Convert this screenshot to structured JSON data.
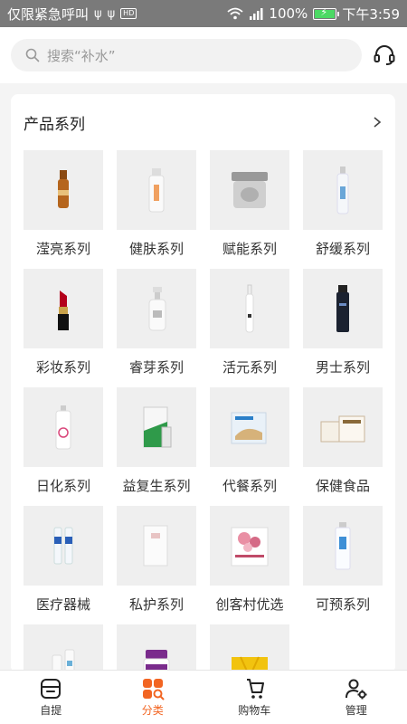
{
  "status_bar": {
    "carrier": "仅限紧急呼叫",
    "extra_icons": [
      "usb-icon",
      "usb-icon",
      "hd-icon"
    ],
    "hd_text": "HD",
    "battery_percent": "100%",
    "battery_level": 1.0,
    "time": "下午3:59"
  },
  "search": {
    "placeholder": "搜索“补水”"
  },
  "section": {
    "title": "产品系列"
  },
  "categories": [
    {
      "label": "滢亮系列",
      "icon": "ampoule"
    },
    {
      "label": "健肤系列",
      "icon": "white-bottle"
    },
    {
      "label": "赋能系列",
      "icon": "silver-jar"
    },
    {
      "label": "舒缓系列",
      "icon": "spray-bottle"
    },
    {
      "label": "彩妆系列",
      "icon": "lipstick"
    },
    {
      "label": "睿芽系列",
      "icon": "pump-bottle"
    },
    {
      "label": "活元系列",
      "icon": "slim-bottle"
    },
    {
      "label": "男士系列",
      "icon": "dark-bottle"
    },
    {
      "label": "日化系列",
      "icon": "pink-spray"
    },
    {
      "label": "益复生系列",
      "icon": "green-box"
    },
    {
      "label": "代餐系列",
      "icon": "food-pack"
    },
    {
      "label": "保健食品",
      "icon": "supplement-box"
    },
    {
      "label": "医疗器械",
      "icon": "tubes"
    },
    {
      "label": "私护系列",
      "icon": "white-box"
    },
    {
      "label": "创客村优选",
      "icon": "flower-pack"
    },
    {
      "label": "可预系列",
      "icon": "tube"
    },
    {
      "label": "",
      "icon": "spray-set"
    },
    {
      "label": "",
      "icon": "pill-jar"
    },
    {
      "label": "",
      "icon": "yellow-bag"
    }
  ],
  "bottom_nav": [
    {
      "label": "自提",
      "icon": "pickup-icon",
      "active": false
    },
    {
      "label": "分类",
      "icon": "category-icon",
      "active": true
    },
    {
      "label": "购物车",
      "icon": "cart-icon",
      "active": false
    },
    {
      "label": "管理",
      "icon": "manage-icon",
      "active": false
    }
  ],
  "colors": {
    "accent": "#f26522",
    "status_bar": "#7a7a7a",
    "thumb_bg": "#efefef"
  }
}
